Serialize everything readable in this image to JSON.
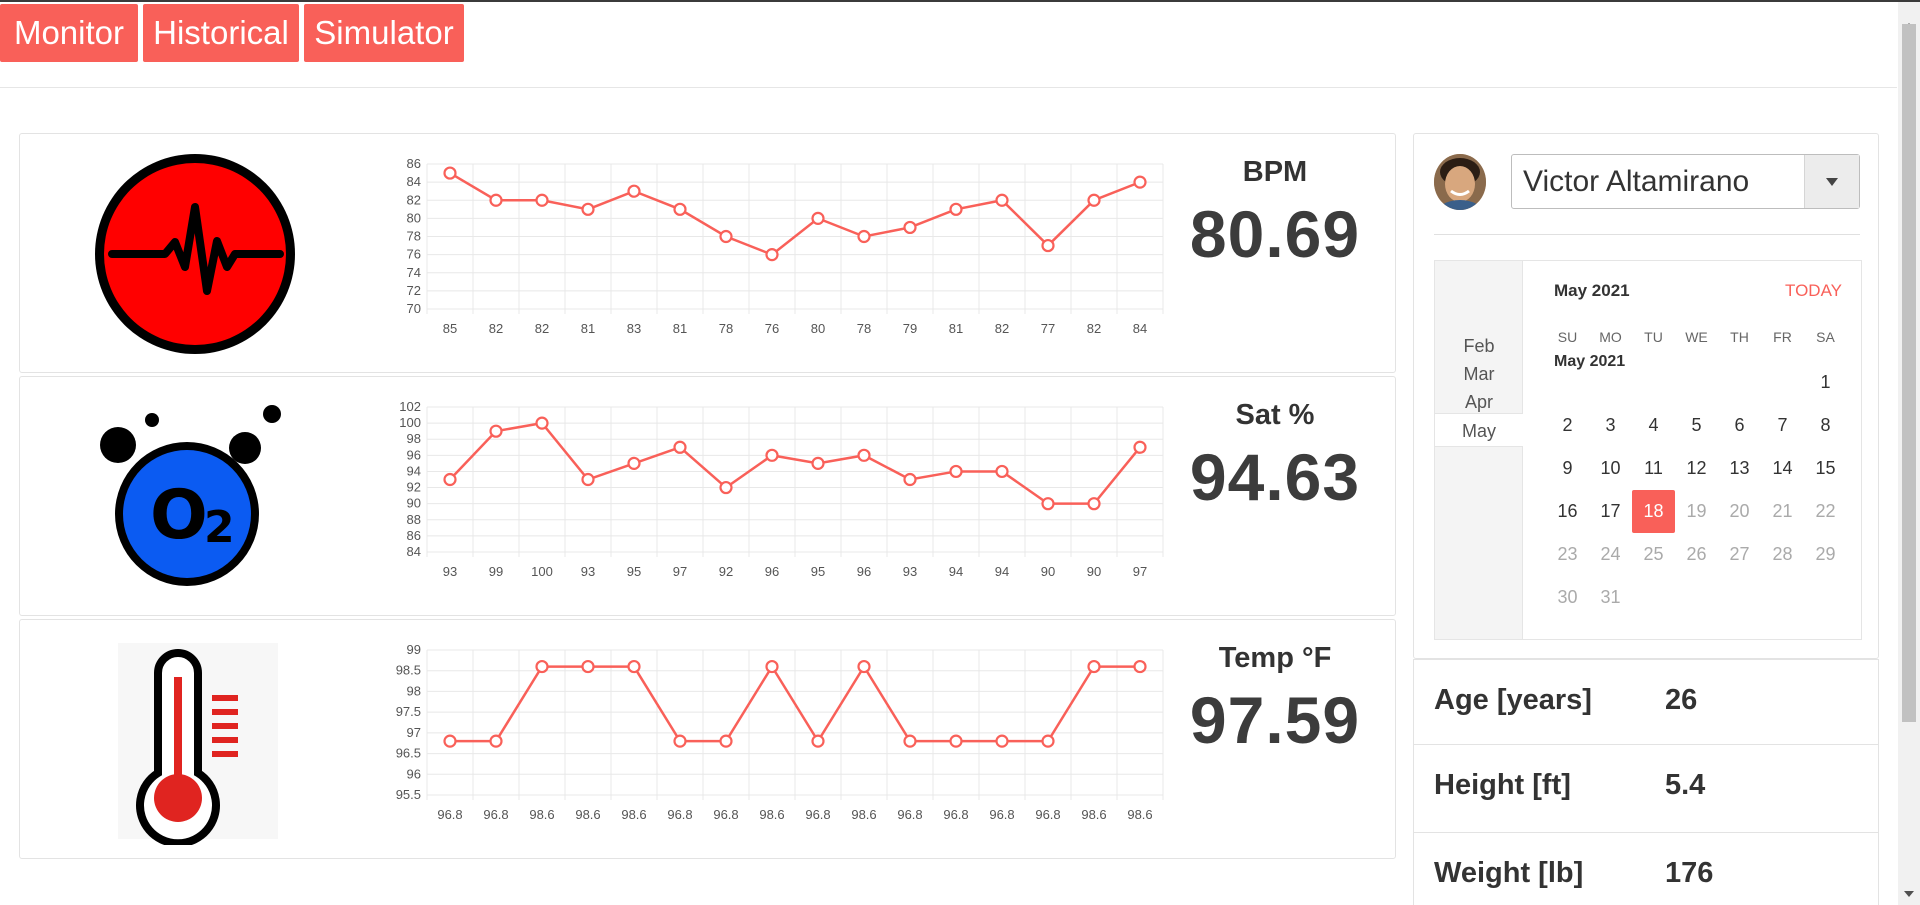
{
  "nav": {
    "items": [
      {
        "label": "Monitor"
      },
      {
        "label": "Historical"
      },
      {
        "label": "Simulator"
      }
    ],
    "accent_color": "#f96059"
  },
  "vitals": [
    {
      "label": "BPM",
      "value": "80.69",
      "icon": "heartbeat-icon"
    },
    {
      "label": "Sat %",
      "value": "94.63",
      "icon": "oxygen-icon"
    },
    {
      "label": "Temp °F",
      "value": "97.59",
      "icon": "thermometer-icon"
    }
  ],
  "profile": {
    "patient_name": "Victor Altamirano",
    "avatar_icon": "avatar-photo"
  },
  "calendar": {
    "months": [
      "Feb",
      "Mar",
      "Apr",
      "May"
    ],
    "active_month": "May",
    "title": "May 2021",
    "subtitle": "May 2021",
    "today_label": "TODAY",
    "weekdays": [
      "SU",
      "MO",
      "TU",
      "WE",
      "TH",
      "FR",
      "SA"
    ],
    "first_weekday_index": 6,
    "days_in_month": 31,
    "selected_day": 18
  },
  "info": {
    "age_label": "Age [years]",
    "age_value": "26",
    "height_label": "Height [ft]",
    "height_value": "5.4",
    "weight_label": "Weight [lb]",
    "weight_value": "176"
  },
  "chart_data": [
    {
      "type": "line",
      "series": [
        {
          "values": [
            85,
            82,
            82,
            81,
            83,
            81,
            78,
            76,
            80,
            78,
            79,
            81,
            82,
            77,
            82,
            84
          ]
        }
      ],
      "categories": [
        "85",
        "82",
        "82",
        "81",
        "83",
        "81",
        "78",
        "76",
        "80",
        "78",
        "79",
        "81",
        "82",
        "77",
        "82",
        "84"
      ],
      "ylim": [
        70,
        86
      ],
      "yticks": [
        "86",
        "84",
        "82",
        "80",
        "78",
        "76",
        "74",
        "72",
        "70"
      ],
      "grid": true,
      "color": "#f96059"
    },
    {
      "type": "line",
      "series": [
        {
          "values": [
            93,
            99,
            100,
            93,
            95,
            97,
            92,
            96,
            95,
            96,
            93,
            94,
            94,
            90,
            90,
            97
          ]
        }
      ],
      "categories": [
        "93",
        "99",
        "100",
        "93",
        "95",
        "97",
        "92",
        "96",
        "95",
        "96",
        "93",
        "94",
        "94",
        "90",
        "90",
        "97"
      ],
      "ylim": [
        84,
        102
      ],
      "yticks": [
        "102",
        "100",
        "98",
        "96",
        "94",
        "92",
        "90",
        "88",
        "86",
        "84"
      ],
      "grid": true,
      "color": "#f96059"
    },
    {
      "type": "line",
      "series": [
        {
          "values": [
            96.8,
            96.8,
            98.6,
            98.6,
            98.6,
            96.8,
            96.8,
            98.6,
            96.8,
            98.6,
            96.8,
            96.8,
            96.8,
            96.8,
            98.6,
            98.6
          ]
        }
      ],
      "categories": [
        "96.8",
        "96.8",
        "98.6",
        "98.6",
        "98.6",
        "96.8",
        "96.8",
        "98.6",
        "96.8",
        "98.6",
        "96.8",
        "96.8",
        "96.8",
        "96.8",
        "98.6",
        "98.6"
      ],
      "ylim": [
        95.5,
        99
      ],
      "yticks": [
        "99",
        "98.5",
        "98",
        "97.5",
        "97",
        "96.5",
        "96",
        "95.5"
      ],
      "grid": true,
      "color": "#f96059"
    }
  ]
}
